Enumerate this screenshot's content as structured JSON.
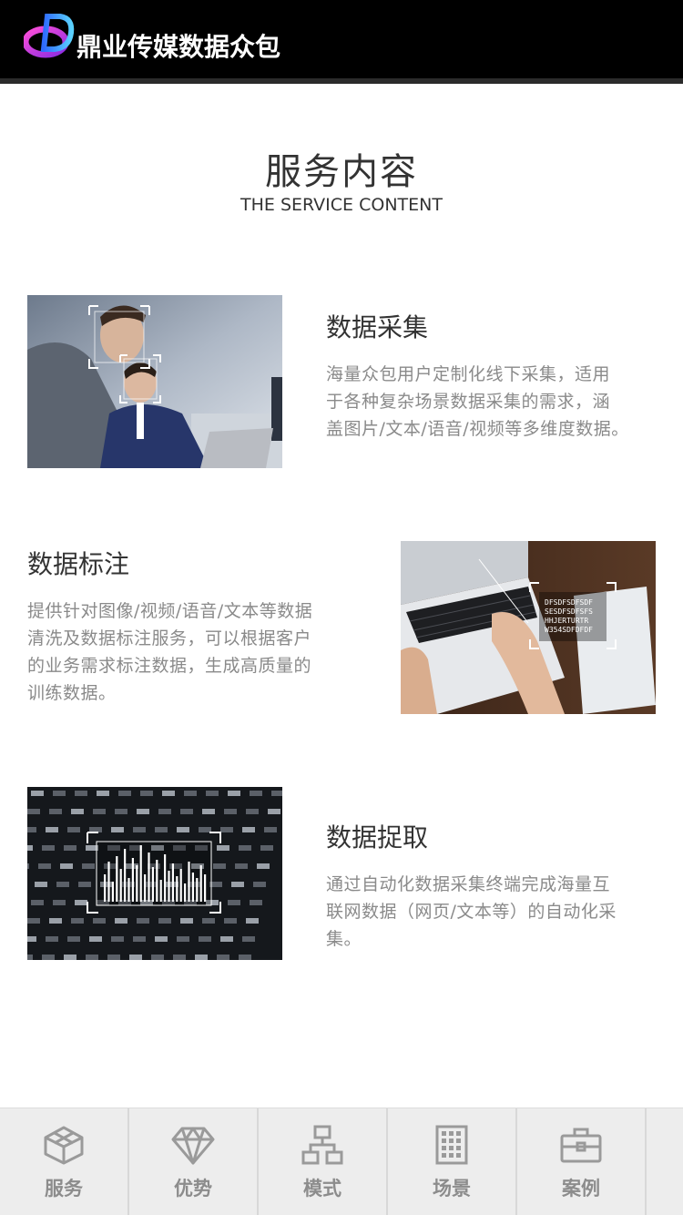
{
  "header": {
    "logo_text": "鼎业传媒数据众包"
  },
  "section": {
    "title": "服务内容",
    "subtitle": "THE SERVICE CONTENT"
  },
  "services": [
    {
      "title": "数据采集",
      "desc_lines": [
        "海量众包用户定制化线下采集，适用",
        "于各种复杂场景数据采集的需求，涵",
        "盖图片/文本/语音/视频等多维度数据。"
      ],
      "image": "data-collection-photo"
    },
    {
      "title": "数据标注",
      "desc_lines": [
        "提供针对图像/视频/语音/文本等数据",
        "清洗及数据标注服务，可以根据客户",
        "的业务需求标注数据，生成高质量的",
        "训练数据。"
      ],
      "image": "data-annotation-photo",
      "overlay_text": [
        "DFSDFSDFSDF",
        "SESDFSDFSFS",
        "HHJERTURTR",
        "W354SDFDFDF"
      ]
    },
    {
      "title": "数据捉取",
      "desc_lines": [
        "通过自动化数据采集终端完成海量互",
        "联网数据（网页/文本等）的自动化采",
        "集。"
      ],
      "image": "data-capture-photo"
    }
  ],
  "tabbar": {
    "tabs": [
      {
        "label": "服务",
        "icon": "cube-icon"
      },
      {
        "label": "优势",
        "icon": "diamond-icon"
      },
      {
        "label": "模式",
        "icon": "hierarchy-icon"
      },
      {
        "label": "场景",
        "icon": "building-icon"
      },
      {
        "label": "案例",
        "icon": "briefcase-icon"
      }
    ]
  },
  "colors": {
    "header_bg": "#000000",
    "title": "#333333",
    "desc": "#8a8a8a",
    "tabbar_bg": "#ededed",
    "tab_icon": "#9a9a9a"
  }
}
